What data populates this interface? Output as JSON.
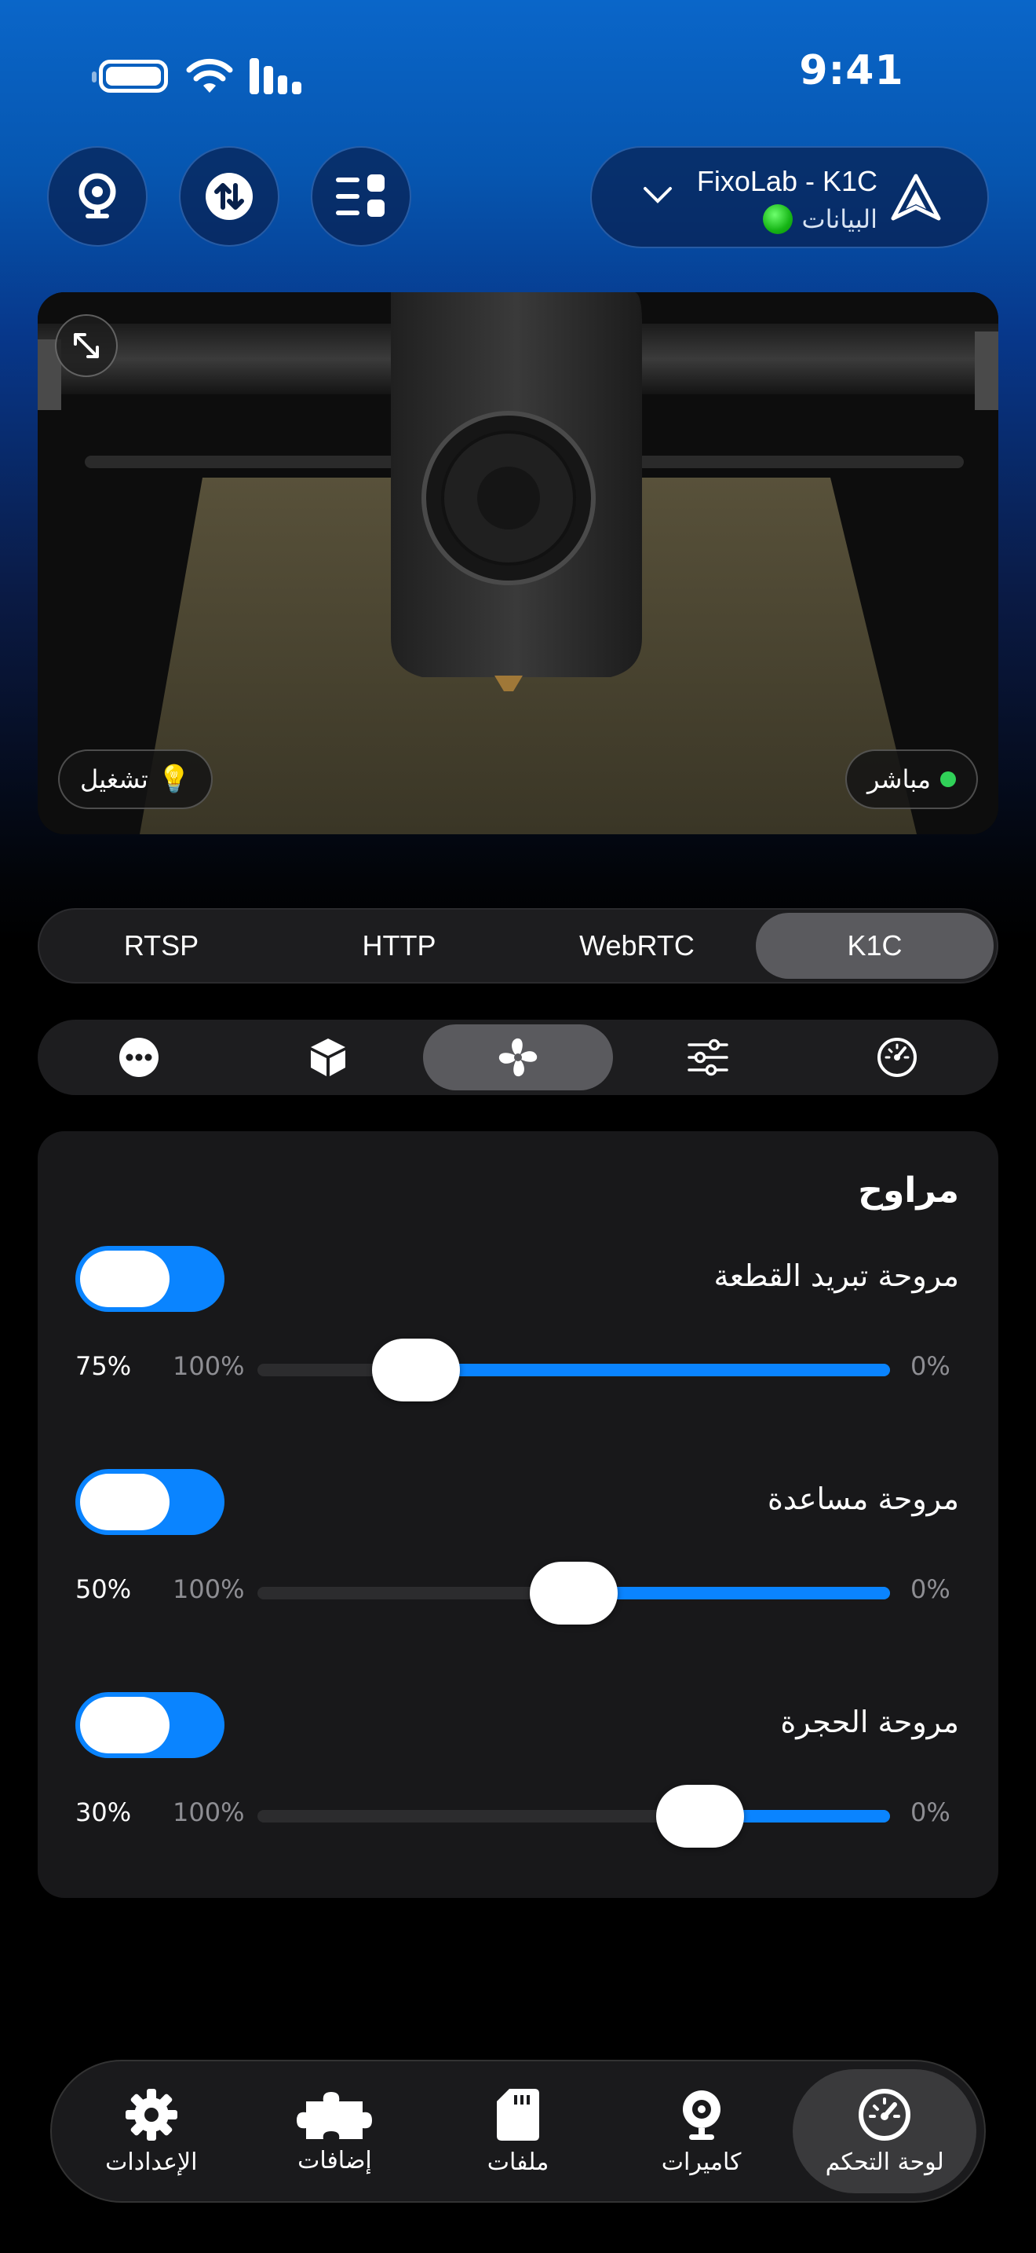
{
  "status_bar": {
    "time": "9:41"
  },
  "printer": {
    "name": "FixoLab - K1C",
    "status": "البيانات"
  },
  "camera": {
    "light_label": "تشغيل",
    "live_label": "مباشر"
  },
  "stream_tabs": [
    {
      "label": "K1C",
      "active": true
    },
    {
      "label": "WebRTC",
      "active": false
    },
    {
      "label": "HTTP",
      "active": false
    },
    {
      "label": "RTSP",
      "active": false
    }
  ],
  "control_tabs": [
    {
      "icon": "speedometer-icon",
      "active": false
    },
    {
      "icon": "sliders-icon",
      "active": false
    },
    {
      "icon": "fan-icon",
      "active": true
    },
    {
      "icon": "box-icon",
      "active": false
    },
    {
      "icon": "more-icon",
      "active": false
    }
  ],
  "fans_card": {
    "title": "مراوح",
    "min_label": "0%",
    "max_label": "100%",
    "fans": [
      {
        "label": "مروحة تبريد القطعة",
        "enabled": true,
        "value": 75,
        "value_label": "75%"
      },
      {
        "label": "مروحة مساعدة",
        "enabled": true,
        "value": 50,
        "value_label": "50%"
      },
      {
        "label": "مروحة الحجرة",
        "enabled": true,
        "value": 30,
        "value_label": "30%"
      }
    ]
  },
  "tab_bar": [
    {
      "label": "لوحة التحكم",
      "icon": "dashboard-icon",
      "active": true
    },
    {
      "label": "كاميرات",
      "icon": "camera-icon",
      "active": false
    },
    {
      "label": "ملفات",
      "icon": "sd-card-icon",
      "active": false
    },
    {
      "label": "إضافات",
      "icon": "puzzle-icon",
      "active": false
    },
    {
      "label": "الإعدادات",
      "icon": "gear-icon",
      "active": false
    }
  ],
  "colors": {
    "accent": "#0a84ff",
    "online": "#16b516"
  }
}
